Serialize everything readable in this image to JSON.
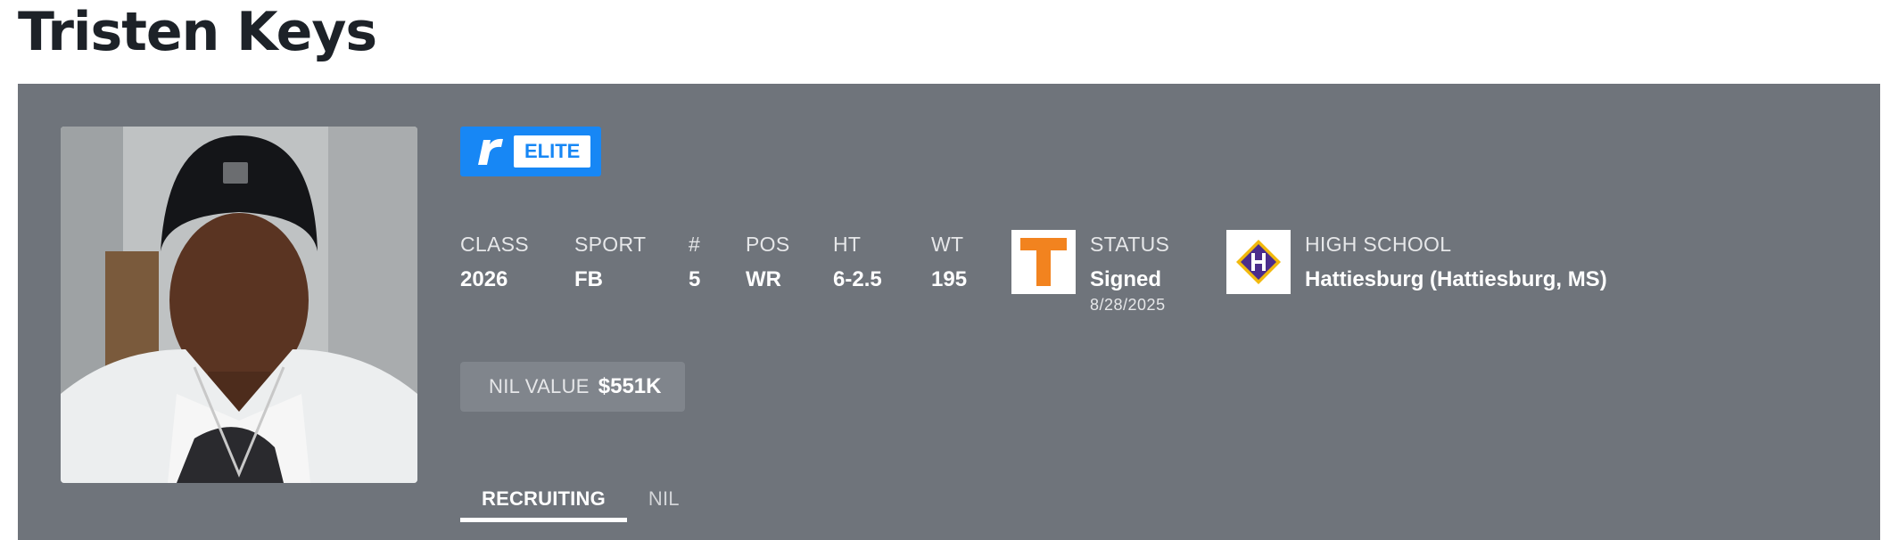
{
  "player": {
    "name": "Tristen Keys",
    "rating_badge": "ELITE",
    "photo_alt_icon": "player-photo"
  },
  "stats": [
    {
      "label": "CLASS",
      "value": "2026"
    },
    {
      "label": "SPORT",
      "value": "FB"
    },
    {
      "label": "#",
      "value": "5"
    },
    {
      "label": "POS",
      "value": "WR"
    },
    {
      "label": "HT",
      "value": "6-2.5"
    },
    {
      "label": "WT",
      "value": "195"
    }
  ],
  "status": {
    "label": "STATUS",
    "value": "Signed",
    "date": "8/28/2025",
    "school_logo_letter": "T"
  },
  "high_school": {
    "label": "HIGH SCHOOL",
    "value": "Hattiesburg (Hattiesburg, MS)",
    "logo_letter": "H"
  },
  "nil": {
    "label": "NIL VALUE",
    "value": "$551K"
  },
  "tabs": [
    {
      "label": "RECRUITING",
      "active": true
    },
    {
      "label": "NIL",
      "active": false
    }
  ],
  "colors": {
    "card_bg": "#6f747b",
    "badge_blue": "#1787f5",
    "tennessee_orange": "#f2831f",
    "hattiesburg_purple": "#4b2d8c",
    "hattiesburg_gold": "#f2b90d"
  }
}
